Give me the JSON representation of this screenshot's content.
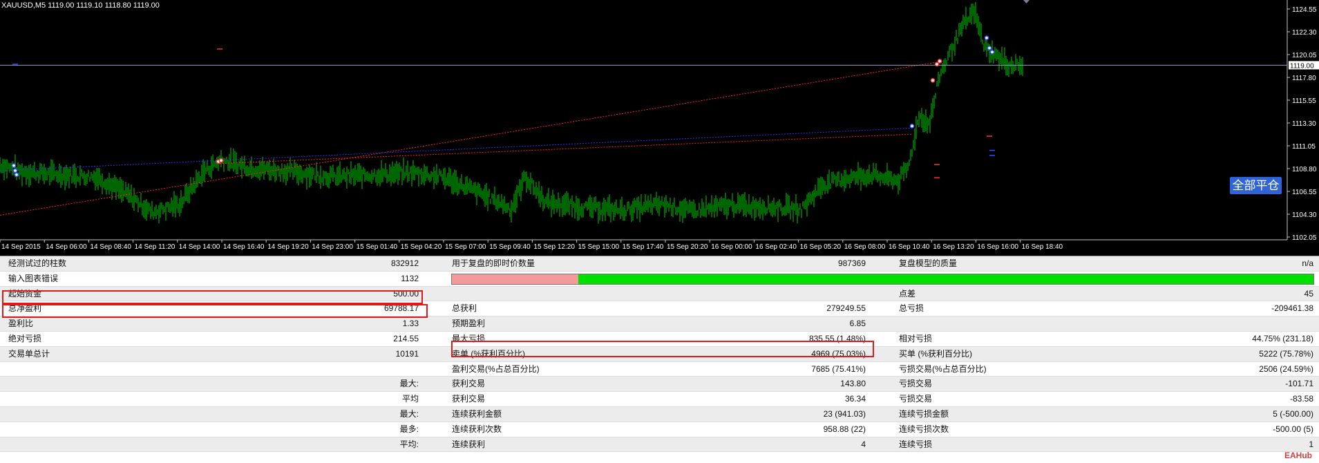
{
  "chart": {
    "symbol": "XAUUSD,M5  1119.00 1119.10 1118.80 1119.00",
    "price_labels": [
      "1124.55",
      "1122.30",
      "1120.05",
      "1117.80",
      "1115.55",
      "1113.30",
      "1111.05",
      "1108.80",
      "1106.55",
      "1104.30",
      "1102.05"
    ],
    "current_price": "1119.00",
    "time_labels": [
      "14 Sep 2015",
      "14 Sep 06:00",
      "14 Sep 08:40",
      "14 Sep 11:20",
      "14 Sep 14:00",
      "14 Sep 16:40",
      "14 Sep 19:20",
      "14 Sep 23:00",
      "15 Sep 01:40",
      "15 Sep 04:20",
      "15 Sep 07:00",
      "15 Sep 09:40",
      "15 Sep 12:20",
      "15 Sep 15:00",
      "15 Sep 17:40",
      "15 Sep 20:20",
      "16 Sep 00:00",
      "16 Sep 02:40",
      "16 Sep 05:20",
      "16 Sep 08:00",
      "16 Sep 10:40",
      "16 Sep 13:20",
      "16 Sep 16:00",
      "16 Sep 18:40"
    ],
    "close_all_label": "全部平仓",
    "colors": {
      "background": "#000000",
      "candles": "#00cc00",
      "bid_line": "#8aa0c8",
      "buy_trend": "#3030ff",
      "sell_trend": "#ff2020"
    }
  },
  "report": {
    "rows": [
      {
        "l1": "经测试过的柱数",
        "v1": "832912",
        "l2": "用于复盘的即时价数量",
        "v2": "987369",
        "l3": "复盘模型的质量",
        "v3": "n/a"
      },
      {
        "l1": "输入图表错误",
        "v1": "1132",
        "quality_bar": {
          "red_fraction": 0.147
        }
      },
      {
        "l1": "起始资金",
        "v1": "500.00",
        "l3": "点差",
        "v3": "45"
      },
      {
        "l1": "总净盈利",
        "v1": "69788.17",
        "l2": "总获利",
        "v2": "279249.55",
        "l3": "总亏损",
        "v3": "-209461.38"
      },
      {
        "l1": "盈利比",
        "v1": "1.33",
        "l2": "预期盈利",
        "v2": "6.85"
      },
      {
        "l1": "绝对亏损",
        "v1": "214.55",
        "l2": "最大亏损",
        "v2": "835.55 (1.48%)",
        "l3": "相对亏损",
        "v3": "44.75% (231.18)"
      },
      {
        "l1": "交易单总计",
        "v1": "10191",
        "l2": "卖单 (%获利百分比)",
        "v2": "4969 (75.03%)",
        "l3": "买单 (%获利百分比)",
        "v3": "5222 (75.78%)"
      },
      {
        "l2": "盈利交易(%占总百分比)",
        "v2": "7685 (75.41%)",
        "l3": "亏损交易(%占总百分比)",
        "v3": "2506 (24.59%)"
      },
      {
        "v1": "最大:",
        "l2": "获利交易",
        "v2": "143.80",
        "l3": "亏损交易",
        "v3": "-101.71"
      },
      {
        "v1": "平均",
        "l2": "获利交易",
        "v2": "36.34",
        "l3": "亏损交易",
        "v3": "-83.58"
      },
      {
        "v1": "最大:",
        "l2": "连续获利金额",
        "v2": "23 (941.03)",
        "l3": "连续亏损金额",
        "v3": "5 (-500.00)"
      },
      {
        "v1": "最多:",
        "l2": "连续获利次数",
        "v2": "958.88 (22)",
        "l3": "连续亏损次数",
        "v3": "-500.00 (5)"
      },
      {
        "v1": "平均:",
        "l2": "连续获利",
        "v2": "4",
        "l3": "连续亏损",
        "v3": "1"
      }
    ]
  },
  "watermark": "EAHub"
}
